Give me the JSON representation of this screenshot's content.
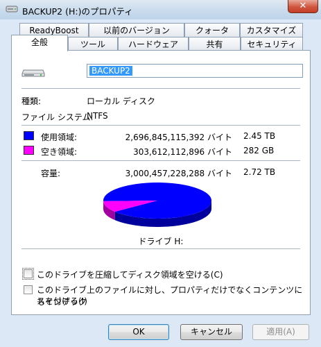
{
  "window": {
    "title": "BACKUP2 (H:)のプロパティ",
    "close_glyph": "✕"
  },
  "tabs_top": [
    "ReadyBoost",
    "以前のバージョン",
    "クォータ",
    "カスタマイズ"
  ],
  "tabs_bottom": [
    "全般",
    "ツール",
    "ハードウェア",
    "共有",
    "セキュリティ"
  ],
  "general": {
    "volume_name": "BACKUP2",
    "type_label": "種類:",
    "type_value": "ローカル ディスク",
    "fs_label": "ファイル システム:",
    "fs_value": "NTFS",
    "used_label": "使用領域:",
    "used_bytes": "2,696,845,115,392 バイト",
    "used_size": "2.45 TB",
    "free_label": "空き領域:",
    "free_bytes": "303,612,112,896 バイト",
    "free_size": "282 GB",
    "capacity_label": "容量:",
    "capacity_bytes": "3,000,457,228,288 バイト",
    "capacity_size": "2.72 TB",
    "drive_label": "ドライブ H:",
    "compress_label": "このドライブを圧縮してディスク領域を空ける(C)",
    "index_label_1": "このドライブ上のファイルに対し、プロパティだけでなくコンテンツにもインデック",
    "index_label_2": "スを付ける(I)"
  },
  "colors": {
    "used": "#0000ff",
    "free": "#ff00ff"
  },
  "pie": {
    "used_fraction": 0.8988,
    "free_fraction": 0.1012
  },
  "buttons": {
    "ok": "OK",
    "cancel": "キャンセル",
    "apply": "適用(A)"
  }
}
